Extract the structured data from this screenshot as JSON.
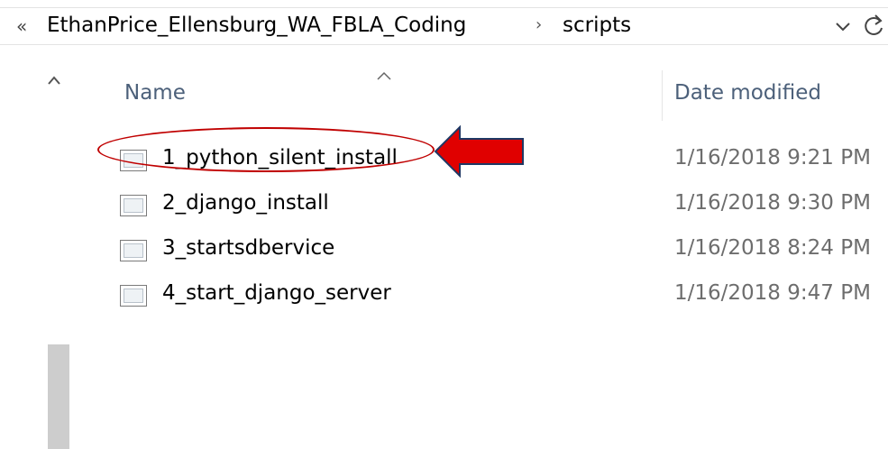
{
  "address_bar": {
    "overflow_glyph": "«",
    "crumbs": [
      "EthanPrice_Ellensburg_WA_FBLA_Coding",
      "scripts"
    ],
    "separator_glyph": "›"
  },
  "columns": {
    "name": "Name",
    "date_modified": "Date modified"
  },
  "files": [
    {
      "name": "1_python_silent_install",
      "date": "1/16/2018 9:21 PM",
      "icon": "script-file-icon",
      "highlighted": true
    },
    {
      "name": "2_django_install",
      "date": "1/16/2018 9:30 PM",
      "icon": "script-file-icon"
    },
    {
      "name": "3_startsdbervice",
      "date": "1/16/2018 8:24 PM",
      "icon": "script-file-icon"
    },
    {
      "name": "4_start_django_server",
      "date": "1/16/2018 9:47 PM",
      "icon": "script-file-icon"
    }
  ],
  "annotation": {
    "color": "#c00000",
    "arrow_fill": "#e00000",
    "arrow_stroke": "#1f3864"
  },
  "colors": {
    "header_text": "#4c607a",
    "date_text": "#6d6d6d",
    "scrollbar_thumb": "#cdcdcd"
  }
}
